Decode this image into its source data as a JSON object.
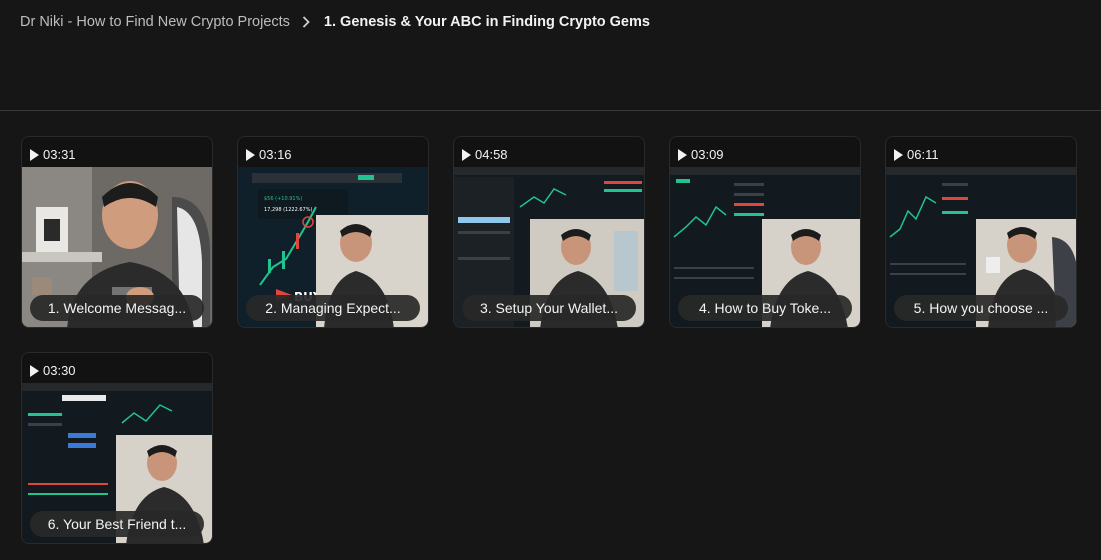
{
  "breadcrumb": {
    "parent": "Dr Niki - How to Find New Crypto Projects",
    "current": "1. Genesis & Your ABC in Finding Crypto Gems"
  },
  "lessons": [
    {
      "duration": "03:31",
      "title": "1. Welcome Messag..."
    },
    {
      "duration": "03:16",
      "title": "2. Managing Expect..."
    },
    {
      "duration": "04:58",
      "title": "3. Setup Your Wallet..."
    },
    {
      "duration": "03:09",
      "title": "4. How to Buy Toke..."
    },
    {
      "duration": "06:11",
      "title": "5. How you choose ..."
    },
    {
      "duration": "03:30",
      "title": "6. Your Best Friend t..."
    }
  ],
  "icons": {
    "separator": "chevron-right-icon",
    "play": "play-icon"
  },
  "colors": {
    "background": "#161616",
    "pill": "#282828",
    "chart_green": "#22c38e",
    "chart_red": "#e0463c"
  }
}
